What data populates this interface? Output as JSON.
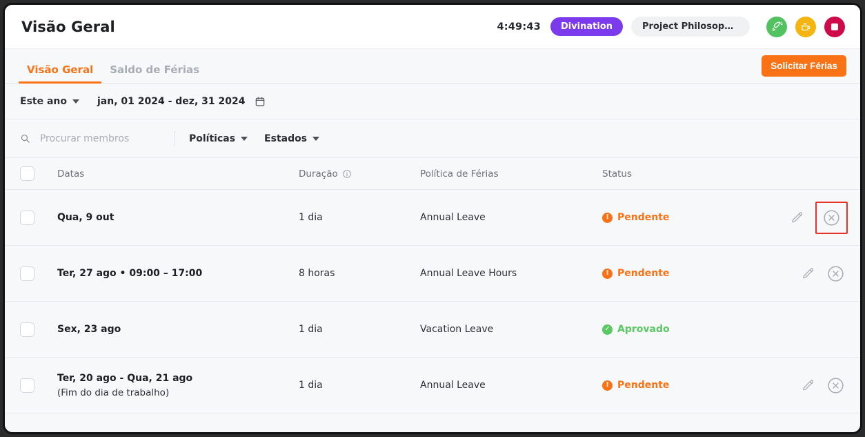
{
  "header": {
    "title": "Visão Geral",
    "timer": "4:49:43",
    "task_badge": "Divination",
    "project_badge": "Project Philosopher's S...",
    "icons": {
      "green": "rocket-icon",
      "yellow": "coffee-break-icon",
      "red": "stop-icon"
    }
  },
  "tabs": [
    {
      "label": "Visão Geral",
      "active": true
    },
    {
      "label": "Saldo de Férias",
      "active": false
    }
  ],
  "actions": {
    "request_leave": "Solicitar Férias"
  },
  "filters": {
    "period": "Este ano",
    "date_range": "jan, 01 2024 - dez, 31 2024",
    "calendar_icon": "calendar-icon",
    "search_placeholder": "Procurar membros",
    "search_value": "",
    "policies": "Políticas",
    "states": "Estados"
  },
  "table": {
    "columns": [
      "Datas",
      "Duração",
      "Política de Férias",
      "Status"
    ],
    "duration_info_icon": "info-icon",
    "rows": [
      {
        "dates": "Qua, 9 out",
        "subtext": "",
        "duration": "1 dia",
        "policy": "Annual Leave",
        "status": "Pendente",
        "status_type": "pending",
        "has_actions": true,
        "highlighted": true
      },
      {
        "dates": "Ter, 27 ago • 09:00 – 17:00",
        "subtext": "",
        "duration": "8 horas",
        "policy": "Annual Leave Hours",
        "status": "Pendente",
        "status_type": "pending",
        "has_actions": true,
        "highlighted": false
      },
      {
        "dates": "Sex, 23 ago",
        "subtext": "",
        "duration": "1 dia",
        "policy": "Vacation Leave",
        "status": "Aprovado",
        "status_type": "approved",
        "has_actions": false,
        "highlighted": false
      },
      {
        "dates": "Ter, 20 ago - Qua, 21 ago",
        "subtext": "(Fim do dia de trabalho)",
        "duration": "1 dia",
        "policy": "Annual Leave",
        "status": "Pendente",
        "status_type": "pending",
        "has_actions": true,
        "highlighted": false
      }
    ]
  },
  "colors": {
    "accent": "#f97316",
    "task_badge": "#7c3aed",
    "approved": "#5bc863",
    "pending": "#f97316",
    "stop": "#cf0a4b",
    "break": "#f5b511",
    "start": "#52c261",
    "highlight": "#e8332a"
  }
}
